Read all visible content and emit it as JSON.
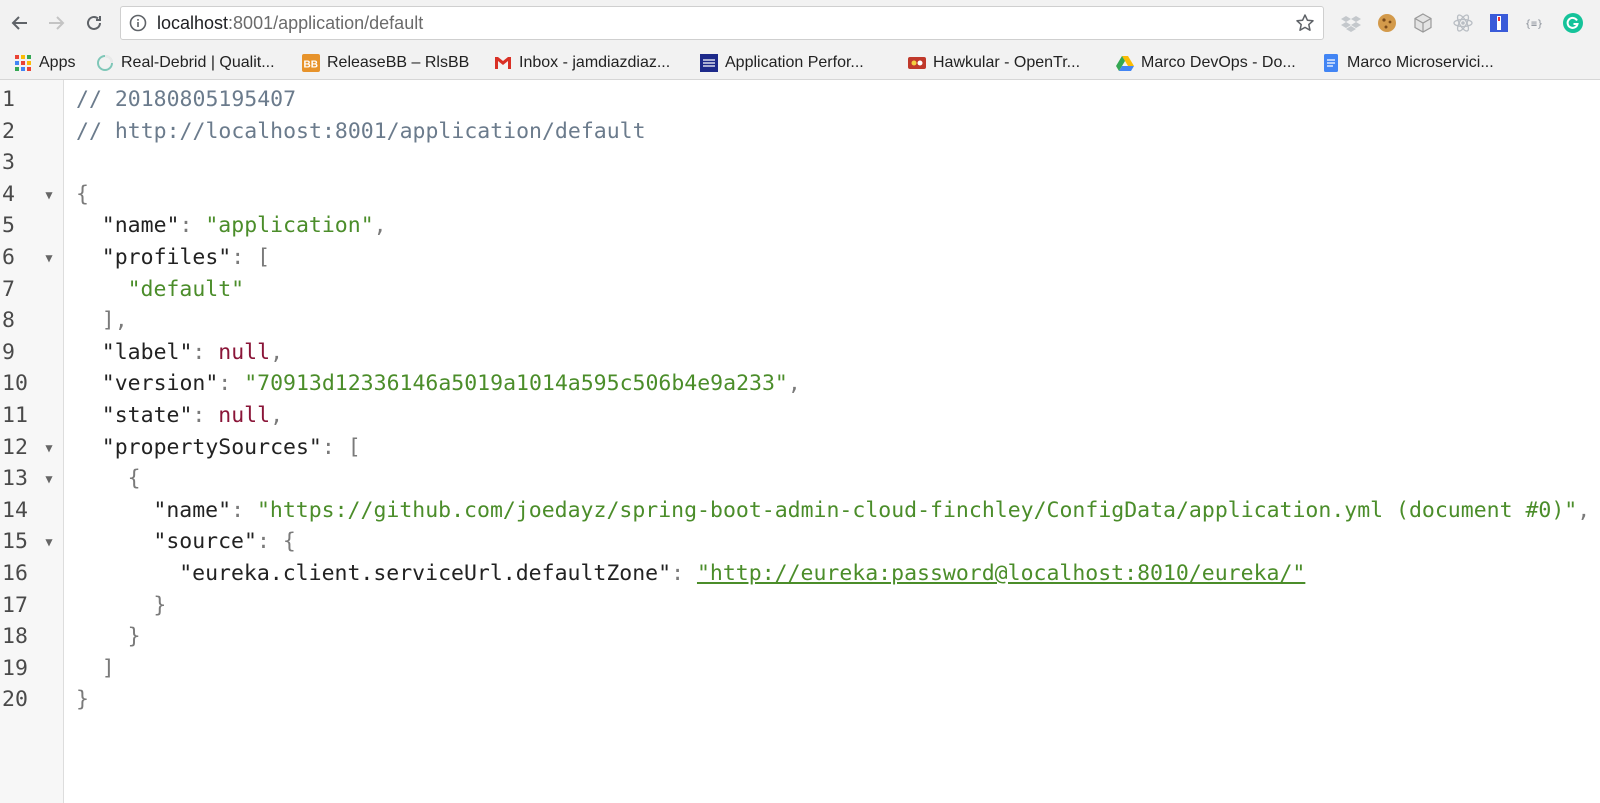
{
  "browser": {
    "url_host": "localhost",
    "url_path": ":8001/application/default"
  },
  "bookmarks": [
    {
      "label": "Apps",
      "icon": "apps-grid-icon"
    },
    {
      "label": "Real-Debrid | Qualit...",
      "icon": "real-debrid-icon"
    },
    {
      "label": "ReleaseBB – RlsBB",
      "icon": "releasebb-icon"
    },
    {
      "label": "Inbox - jamdiazdiaz...",
      "icon": "gmail-icon"
    },
    {
      "label": "Application Perfor...",
      "icon": "app-performance-icon"
    },
    {
      "label": "Hawkular - OpenTr...",
      "icon": "hawkular-icon"
    },
    {
      "label": "Marco DevOps - Do...",
      "icon": "google-drive-icon"
    },
    {
      "label": "Marco Microservici...",
      "icon": "google-docs-icon"
    }
  ],
  "extensions": [
    "dropbox-icon",
    "cookie-icon",
    "cube-icon",
    "react-icon",
    "tag-icon",
    "json-viewer-icon",
    "grammarly-icon"
  ],
  "json_viewer": {
    "lines": [
      {
        "n": "1",
        "fold": false,
        "indent": 0,
        "tokens": [
          {
            "t": "comment",
            "v": "// 20180805195407"
          }
        ]
      },
      {
        "n": "2",
        "fold": false,
        "indent": 0,
        "tokens": [
          {
            "t": "comment",
            "v": "// http://localhost:8001/application/default"
          }
        ]
      },
      {
        "n": "3",
        "fold": false,
        "indent": 0,
        "tokens": []
      },
      {
        "n": "4",
        "fold": true,
        "indent": 0,
        "tokens": [
          {
            "t": "punc",
            "v": "{"
          }
        ]
      },
      {
        "n": "5",
        "fold": false,
        "indent": 1,
        "tokens": [
          {
            "t": "key",
            "v": "\"name\""
          },
          {
            "t": "punc",
            "v": ": "
          },
          {
            "t": "str",
            "v": "\"application\""
          },
          {
            "t": "punc",
            "v": ","
          }
        ]
      },
      {
        "n": "6",
        "fold": true,
        "indent": 1,
        "tokens": [
          {
            "t": "key",
            "v": "\"profiles\""
          },
          {
            "t": "punc",
            "v": ": ["
          }
        ]
      },
      {
        "n": "7",
        "fold": false,
        "indent": 2,
        "tokens": [
          {
            "t": "str",
            "v": "\"default\""
          }
        ]
      },
      {
        "n": "8",
        "fold": false,
        "indent": 1,
        "tokens": [
          {
            "t": "punc",
            "v": "],"
          }
        ]
      },
      {
        "n": "9",
        "fold": false,
        "indent": 1,
        "tokens": [
          {
            "t": "key",
            "v": "\"label\""
          },
          {
            "t": "punc",
            "v": ": "
          },
          {
            "t": "null",
            "v": "null"
          },
          {
            "t": "punc",
            "v": ","
          }
        ]
      },
      {
        "n": "10",
        "fold": false,
        "indent": 1,
        "tokens": [
          {
            "t": "key",
            "v": "\"version\""
          },
          {
            "t": "punc",
            "v": ": "
          },
          {
            "t": "str",
            "v": "\"70913d12336146a5019a1014a595c506b4e9a233\""
          },
          {
            "t": "punc",
            "v": ","
          }
        ]
      },
      {
        "n": "11",
        "fold": false,
        "indent": 1,
        "tokens": [
          {
            "t": "key",
            "v": "\"state\""
          },
          {
            "t": "punc",
            "v": ": "
          },
          {
            "t": "null",
            "v": "null"
          },
          {
            "t": "punc",
            "v": ","
          }
        ]
      },
      {
        "n": "12",
        "fold": true,
        "indent": 1,
        "tokens": [
          {
            "t": "key",
            "v": "\"propertySources\""
          },
          {
            "t": "punc",
            "v": ": ["
          }
        ]
      },
      {
        "n": "13",
        "fold": true,
        "indent": 2,
        "tokens": [
          {
            "t": "punc",
            "v": "{"
          }
        ]
      },
      {
        "n": "14",
        "fold": false,
        "indent": 3,
        "tokens": [
          {
            "t": "key",
            "v": "\"name\""
          },
          {
            "t": "punc",
            "v": ": "
          },
          {
            "t": "str",
            "v": "\"https://github.com/joedayz/spring-boot-admin-cloud-finchley/ConfigData/application.yml (document #0)\""
          },
          {
            "t": "punc",
            "v": ","
          }
        ]
      },
      {
        "n": "15",
        "fold": true,
        "indent": 3,
        "tokens": [
          {
            "t": "key",
            "v": "\"source\""
          },
          {
            "t": "punc",
            "v": ": {"
          }
        ]
      },
      {
        "n": "16",
        "fold": false,
        "indent": 4,
        "tokens": [
          {
            "t": "key",
            "v": "\"eureka.client.serviceUrl.defaultZone\""
          },
          {
            "t": "punc",
            "v": ": "
          },
          {
            "t": "link",
            "v": "\"http://eureka:password@localhost:8010/eureka/\""
          }
        ]
      },
      {
        "n": "17",
        "fold": false,
        "indent": 3,
        "tokens": [
          {
            "t": "punc",
            "v": "}"
          }
        ]
      },
      {
        "n": "18",
        "fold": false,
        "indent": 2,
        "tokens": [
          {
            "t": "punc",
            "v": "}"
          }
        ]
      },
      {
        "n": "19",
        "fold": false,
        "indent": 1,
        "tokens": [
          {
            "t": "punc",
            "v": "]"
          }
        ]
      },
      {
        "n": "20",
        "fold": false,
        "indent": 0,
        "tokens": [
          {
            "t": "punc",
            "v": "}"
          }
        ]
      }
    ]
  }
}
